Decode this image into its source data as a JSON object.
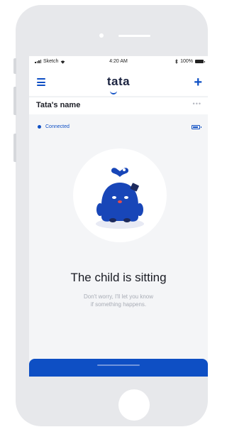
{
  "status_bar": {
    "carrier": "Sketch",
    "time": "4:20 AM",
    "battery_pct": "100%"
  },
  "nav": {
    "logo": "tata",
    "menu_icon": "hamburger-menu-icon",
    "add_icon": "plus-icon"
  },
  "device": {
    "name": "Tata's name",
    "more_label": "•••",
    "connection_status": "Connected"
  },
  "state": {
    "title": "The child is sitting",
    "message_line1": "Don't worry, I'll let you know",
    "message_line2": "if something happens."
  },
  "colors": {
    "accent": "#0e4fc4",
    "mascot": "#1846b8",
    "background": "#f4f5f7"
  }
}
